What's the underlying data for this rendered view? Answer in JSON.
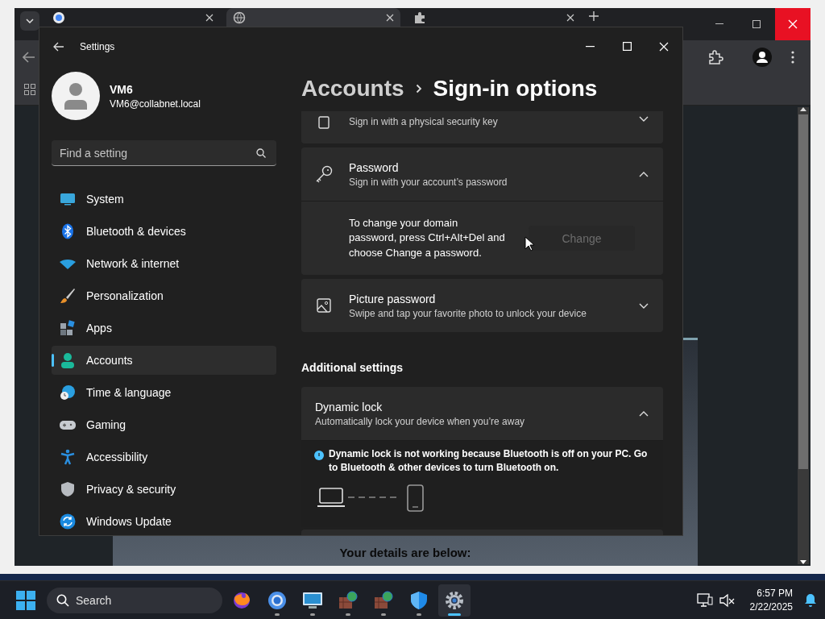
{
  "browser": {
    "tabs": [
      {
        "selected": false
      },
      {
        "selected": true
      },
      {
        "selected": false
      }
    ],
    "page_heading": "Your details are below:"
  },
  "settings": {
    "title": "Settings",
    "user": {
      "name": "VM6",
      "email": "VM6@collabnet.local"
    },
    "search": {
      "placeholder": "Find a setting"
    },
    "nav": [
      {
        "label": "System",
        "selected": false
      },
      {
        "label": "Bluetooth & devices",
        "selected": false
      },
      {
        "label": "Network & internet",
        "selected": false
      },
      {
        "label": "Personalization",
        "selected": false
      },
      {
        "label": "Apps",
        "selected": false
      },
      {
        "label": "Accounts",
        "selected": true
      },
      {
        "label": "Time & language",
        "selected": false
      },
      {
        "label": "Gaming",
        "selected": false
      },
      {
        "label": "Accessibility",
        "selected": false
      },
      {
        "label": "Privacy & security",
        "selected": false
      },
      {
        "label": "Windows Update",
        "selected": false
      }
    ],
    "breadcrumb": {
      "parent": "Accounts",
      "current": "Sign-in options"
    },
    "cards": [
      {
        "subtitle": "Sign in with a physical security key",
        "expanded": false
      },
      {
        "title": "Password",
        "subtitle": "Sign in with your account’s password",
        "expanded": true,
        "body": "To change your domain password, press Ctrl+Alt+Del and choose Change a password.",
        "action": {
          "label": "Change",
          "disabled": true
        }
      },
      {
        "title": "Picture password",
        "subtitle": "Swipe and tap your favorite photo to unlock your device",
        "expanded": false
      }
    ],
    "section_heading": "Additional settings",
    "additional_cards": [
      {
        "title": "Dynamic lock",
        "subtitle": "Automatically lock your device when you’re away",
        "expanded": true,
        "notice": "Dynamic lock is not working because Bluetooth is off on your PC. Go to Bluetooth & other devices to turn Bluetooth on."
      }
    ]
  },
  "taskbar": {
    "search_placeholder": "Search",
    "apps": [
      {
        "selected": false,
        "running": false
      },
      {
        "selected": false,
        "running": true
      },
      {
        "selected": false,
        "running": true
      },
      {
        "selected": false,
        "running": true
      },
      {
        "selected": false,
        "running": true
      },
      {
        "selected": false,
        "running": true
      },
      {
        "selected": true,
        "running": true
      }
    ],
    "clock": {
      "time": "6:57 PM",
      "date": "2/22/2025"
    }
  }
}
